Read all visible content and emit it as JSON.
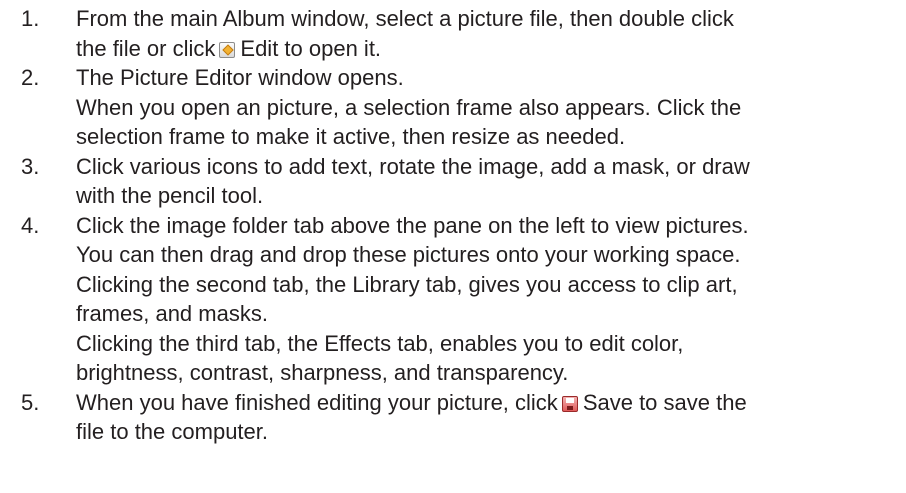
{
  "steps": [
    {
      "number": "1.",
      "lines": [
        "From the main Album window, select a picture file, then double click",
        "the file or click",
        "Edit to open it."
      ],
      "icon": "edit-icon"
    },
    {
      "number": "2.",
      "lines": [
        "The Picture Editor window opens.",
        "When you open an picture, a selection frame also appears. Click the",
        "selection frame to make it active, then resize as needed."
      ]
    },
    {
      "number": "3.",
      "lines": [
        "Click various icons to add text, rotate the image, add a mask, or draw",
        "with the pencil tool."
      ]
    },
    {
      "number": "4.",
      "lines": [
        "Click the image folder tab above the pane on the left to view pictures.",
        "You can then drag and drop these pictures onto your working space.",
        "Clicking the second tab, the Library tab, gives you access to clip art,",
        "frames, and masks.",
        "Clicking the third tab, the Effects tab, enables you to edit color,",
        "brightness, contrast, sharpness, and transparency."
      ]
    },
    {
      "number": "5.",
      "lines": [
        "When you have finished editing your picture, click",
        "Save to save the",
        "file to the computer."
      ],
      "icon": "save-icon"
    }
  ]
}
